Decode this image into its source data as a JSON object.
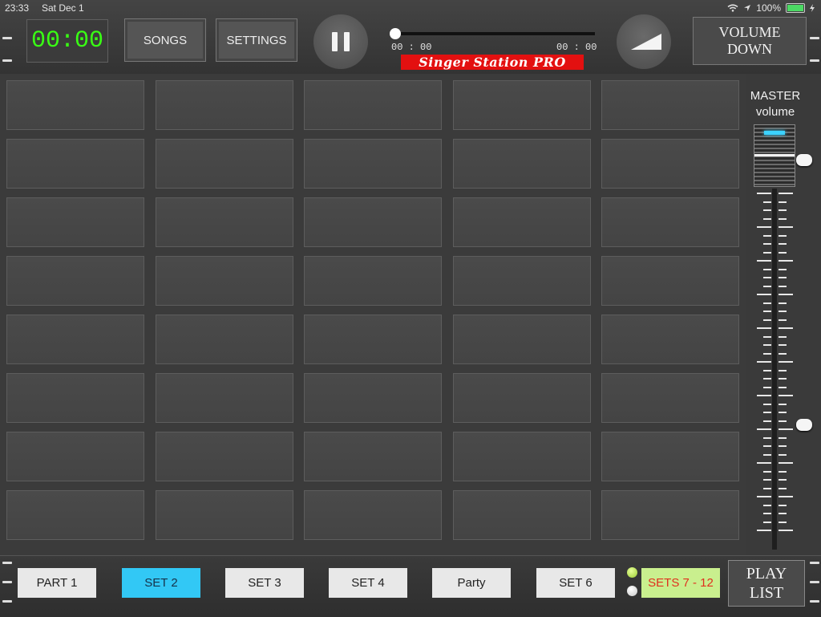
{
  "status_bar": {
    "time": "23:33",
    "date": "Sat Dec 1",
    "battery": "100%"
  },
  "header": {
    "timer": "00:00",
    "songs_label": "SONGS",
    "settings_label": "SETTINGS",
    "elapsed": "00 : 00",
    "remaining": "00 : 00",
    "logo_text": "Singer Station PRO",
    "volume_down_line1": "VOLUME",
    "volume_down_line2": "DOWN",
    "playback_progress": 0
  },
  "master": {
    "label_line1": "MASTER",
    "label_line2": "volume",
    "led_color": "#3cd2ff"
  },
  "pads": {
    "rows": 8,
    "columns": 5
  },
  "footer": {
    "sets": [
      {
        "label": "PART 1",
        "active": false
      },
      {
        "label": "SET 2",
        "active": true
      },
      {
        "label": "SET 3",
        "active": false
      },
      {
        "label": "SET 4",
        "active": false
      },
      {
        "label": "Party",
        "active": false
      },
      {
        "label": "SET 6",
        "active": false
      }
    ],
    "sets_range_label": "SETS 7 - 12",
    "playlist_line1": "PLAY",
    "playlist_line2": "LIST",
    "led_top_color": "#9acd32",
    "led_bottom_color": "#c8c8c8"
  },
  "colors": {
    "timer": "#39ff14",
    "active_set": "#32c8f5",
    "sets_range_bg": "#c9ef8e",
    "sets_range_text": "#e0301e",
    "logo_bg": "#e31010"
  }
}
